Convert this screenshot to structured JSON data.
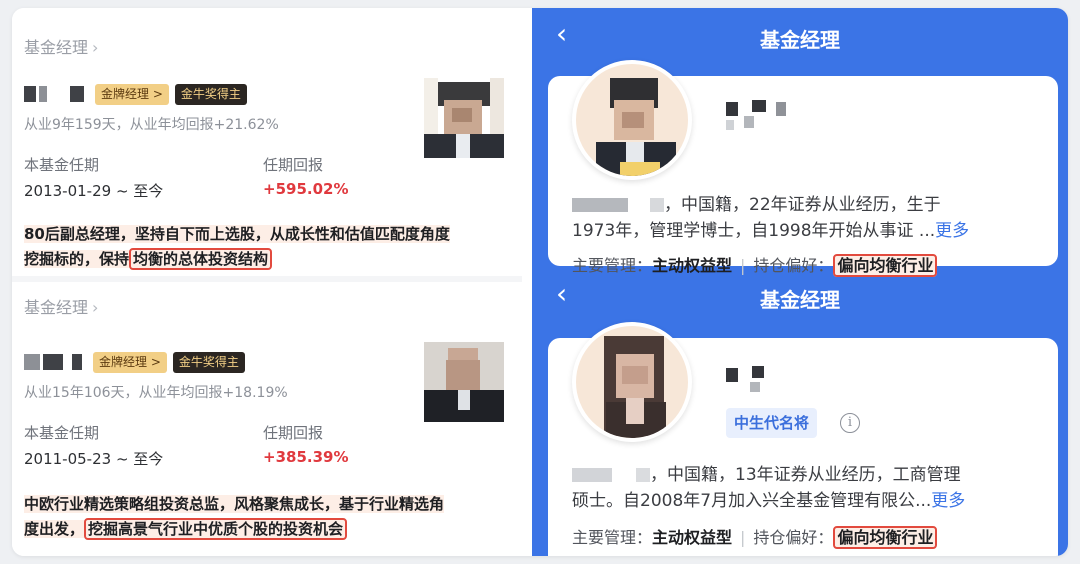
{
  "left": {
    "cards": [
      {
        "section_title": "基金经理",
        "tag_gold": "金牌经理 >",
        "tag_award": "金牛奖得主",
        "years": "从业9年159天，从业年均回报+21.62%",
        "tenure_label": "本基金任期",
        "tenure_value": "2013-01-29 ~ 至今",
        "return_label": "任期回报",
        "return_value": "+595.02%",
        "desc_line1": "80后副总经理，坚持自下而上选股，从成长性和估值匹配度角度",
        "desc_line2_pre": "挖掘标的，保持",
        "desc_line2_boxed": "均衡的总体投资结构"
      },
      {
        "section_title": "基金经理",
        "tag_gold": "金牌经理 >",
        "tag_award": "金牛奖得主",
        "years": "从业15年106天，从业年均回报+18.19%",
        "tenure_label": "本基金任期",
        "tenure_value": "2011-05-23 ~ 至今",
        "return_label": "任期回报",
        "return_value": "+385.39%",
        "desc_line1": "中欧行业精选策略组投资总监，风格聚焦成长，基于行业精选角",
        "desc_line2_pre": "度出发，",
        "desc_line2_boxed": "挖掘高景气行业中优质个股的投资机会"
      }
    ]
  },
  "right": {
    "panels": [
      {
        "title": "基金经理",
        "back_icon": "‹",
        "bio_line1": "，中国籍，22年证券从业经历，生于",
        "bio_line2": "1973年，管理学博士，自1998年开始从事证 ...",
        "more": "更多",
        "meta_label1": "主要管理：",
        "meta_value1": "主动权益型",
        "meta_label2": "持仓偏好：",
        "meta_value2": "偏向均衡行业"
      },
      {
        "title": "基金经理",
        "back_icon": "‹",
        "badge": "中生代名将",
        "info_icon": "i",
        "bio_line1": "，中国籍，13年证券从业经历，工商管理",
        "bio_line2": "硕士。自2008年7月加入兴全基金管理有限公...",
        "more": "更多",
        "meta_label1": "主要管理：",
        "meta_value1": "主动权益型",
        "meta_label2": "持仓偏好：",
        "meta_value2": "偏向均衡行业"
      }
    ]
  },
  "colors": {
    "accent_blue": "#3b74e6",
    "return_red": "#e0393e",
    "gold_tag": "#f2cf86",
    "highlight_box": "#e24a3e"
  }
}
